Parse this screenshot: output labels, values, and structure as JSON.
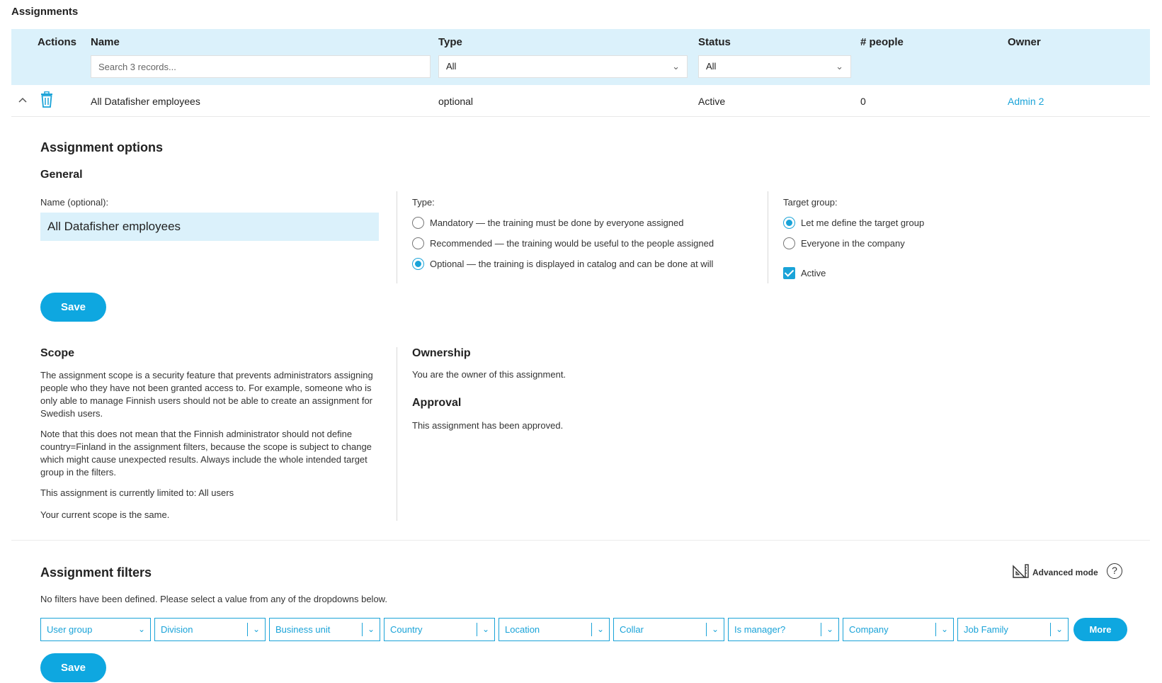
{
  "page": {
    "title": "Assignments"
  },
  "grid": {
    "headers": {
      "actions": "Actions",
      "name": "Name",
      "type": "Type",
      "status": "Status",
      "people": "# people",
      "owner": "Owner"
    },
    "filters": {
      "search_placeholder": "Search 3 records...",
      "type_value": "All",
      "status_value": "All"
    },
    "row": {
      "name": "All Datafisher employees",
      "type": "optional",
      "status": "Active",
      "people": "0",
      "owner": "Admin 2"
    }
  },
  "options": {
    "title": "Assignment options",
    "general": {
      "title": "General",
      "name_label": "Name (optional):",
      "name_value": "All Datafisher employees",
      "type_label": "Type:",
      "types": [
        {
          "label": "Mandatory — the training must be done by everyone assigned",
          "selected": false
        },
        {
          "label": "Recommended — the training would be useful to the people assigned",
          "selected": false
        },
        {
          "label": "Optional — the training is displayed in catalog and can be done at will",
          "selected": true
        }
      ],
      "target_label": "Target group:",
      "targets": [
        {
          "label": "Let me define the target group",
          "selected": true
        },
        {
          "label": "Everyone in the company",
          "selected": false
        }
      ],
      "active_label": "Active",
      "active_checked": true,
      "save_label": "Save"
    },
    "scope": {
      "title": "Scope",
      "paragraphs": [
        "The assignment scope is a security feature that prevents administrators assigning people who they have not been granted access to. For example, someone who is only able to manage Finnish users should not be able to create an assignment for Swedish users.",
        "Note that this does not mean that the Finnish administrator should not define country=Finland in the assignment filters, because the scope is subject to change which might cause unexpected results. Always include the whole intended target group in the filters.",
        "This assignment is currently limited to: All users",
        "Your current scope is the same."
      ]
    },
    "ownership": {
      "title": "Ownership",
      "text": "You are the owner of this assignment."
    },
    "approval": {
      "title": "Approval",
      "text": "This assignment has been approved."
    }
  },
  "filters": {
    "title": "Assignment filters",
    "advanced_label": "Advanced mode",
    "help_glyph": "?",
    "empty_text": "No filters have been defined. Please select a value from any of the dropdowns below.",
    "dropdowns": [
      "User group",
      "Division",
      "Business unit",
      "Country",
      "Location",
      "Collar",
      "Is manager?",
      "Company",
      "Job Family"
    ],
    "more_label": "More",
    "save_label": "Save"
  },
  "colors": {
    "accent": "#1aa3d8",
    "header_bg": "#dbf1fb",
    "button": "#0ea7e0"
  }
}
